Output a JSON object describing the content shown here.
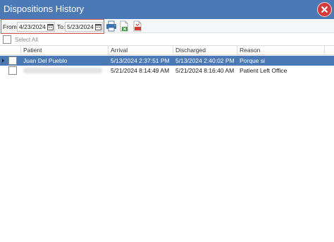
{
  "window": {
    "title": "Dispositions History",
    "close_icon": "close-icon",
    "titlebar_color": "#4a79b6",
    "close_color": "#d63a3a"
  },
  "toolbar": {
    "from_label": "From:",
    "from_value": "4/23/2024",
    "to_label": "To:",
    "to_value": "5/23/2024",
    "highlight_color": "#d9534f",
    "icons": [
      "calendar-icon",
      "printer-icon",
      "export-excel-icon",
      "export-pdf-icon"
    ]
  },
  "select_all": {
    "label": "Select All"
  },
  "grid": {
    "columns": [
      "Patient",
      "Arrival",
      "Discharged",
      "Reason"
    ],
    "selection_color": "#4a79b6",
    "rows": [
      {
        "patient": "Juan Del Pueblo",
        "arrival": "5/13/2024 2:37:51 PM",
        "discharged": "5/13/2024 2:40:02 PM",
        "reason": "Porque si",
        "selected": true
      },
      {
        "patient": "",
        "patient_redacted": true,
        "arrival": "5/21/2024 8:14:49 AM",
        "discharged": "5/21/2024 8:16:40 AM",
        "reason": "Patient Left Office",
        "selected": false
      }
    ]
  }
}
